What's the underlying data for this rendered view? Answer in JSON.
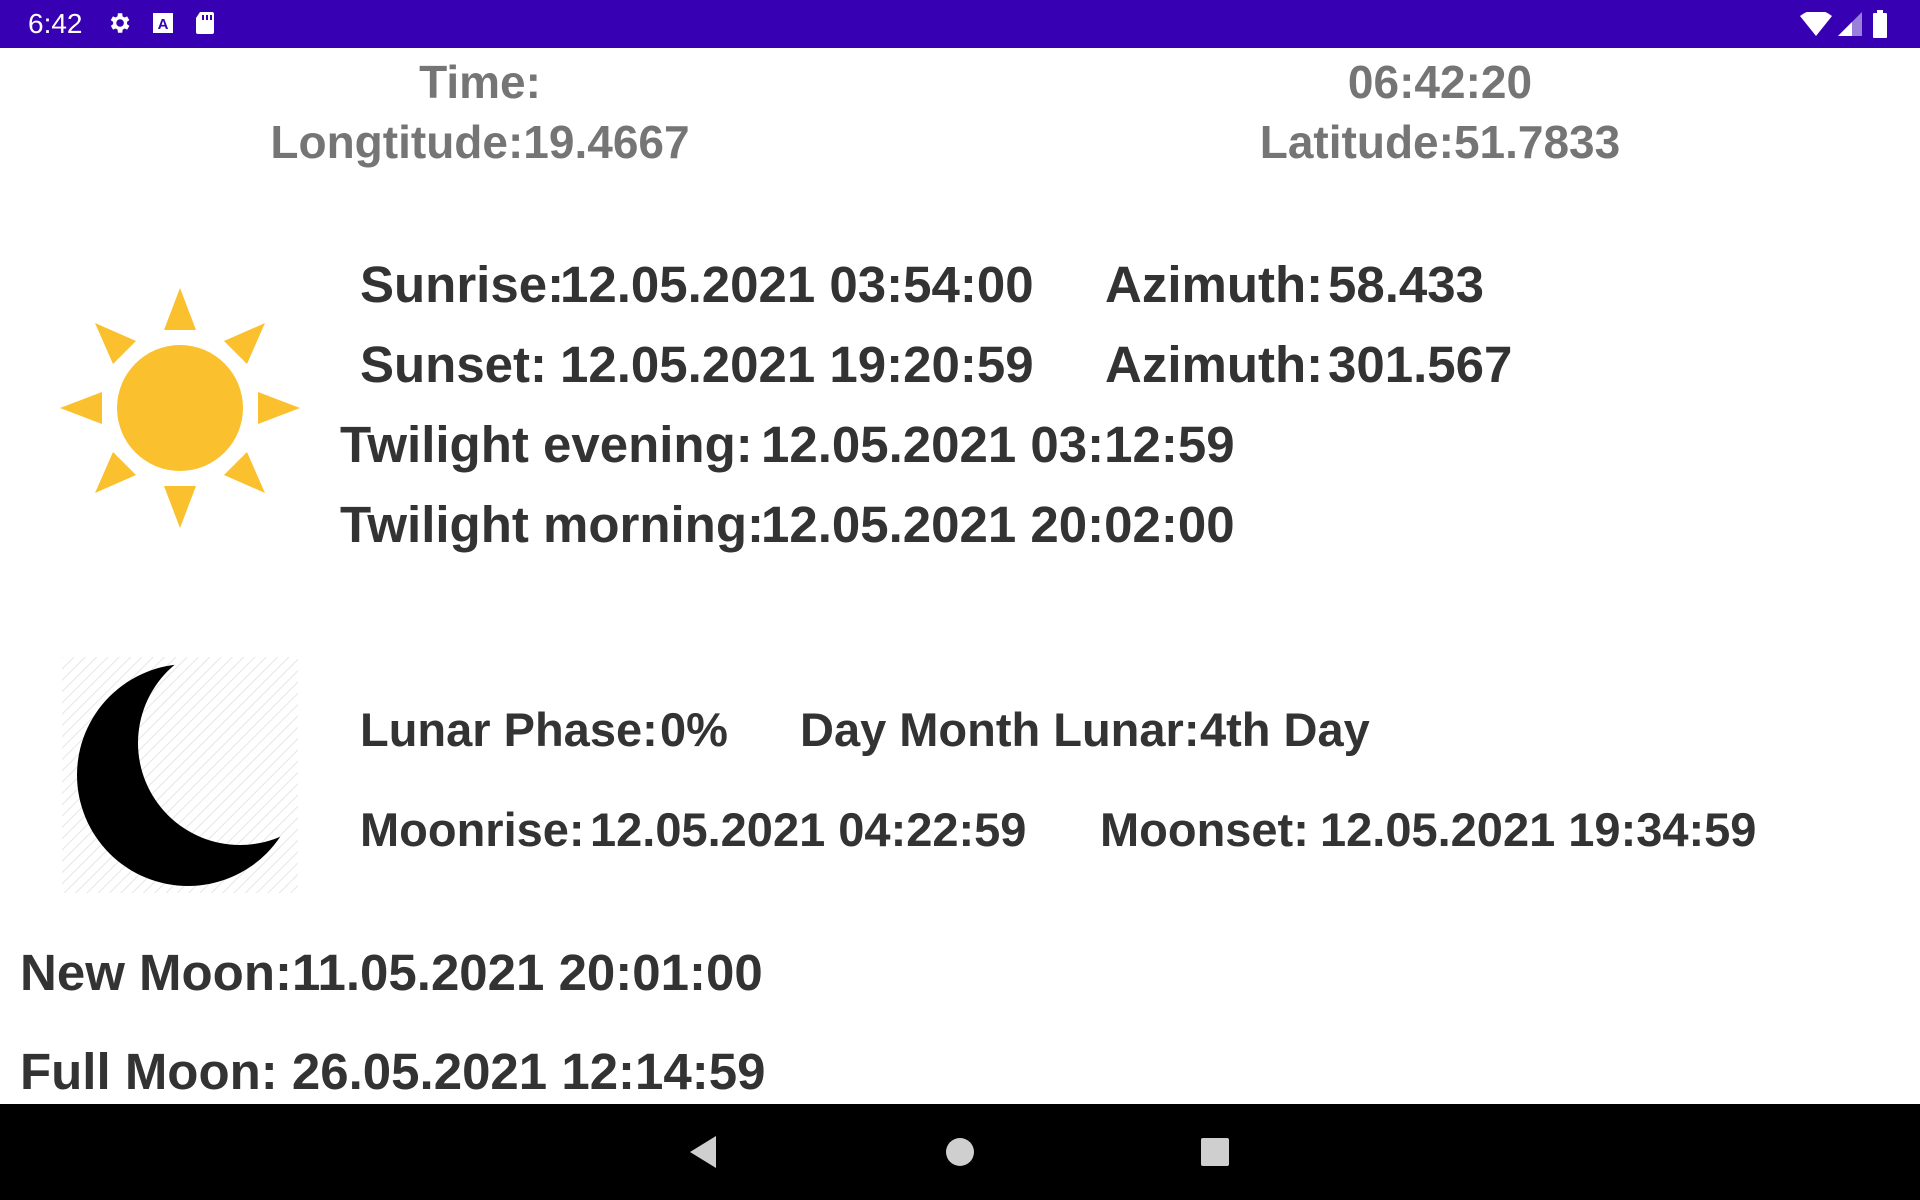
{
  "status_bar": {
    "time": "6:42",
    "icons": [
      "settings-icon",
      "a-notification-icon",
      "sd-card-icon",
      "wifi-icon",
      "signal-icon",
      "battery-icon"
    ]
  },
  "header": {
    "time_label": "Time:",
    "time_value": "06:42:20",
    "longitude": "Longtitude:19.4667",
    "latitude": "Latitude:51.7833"
  },
  "sun": {
    "icon": "sun-icon",
    "sunrise_label": "Sunrise:",
    "sunrise_value": "12.05.2021 03:54:00",
    "sunrise_azimuth_label": "Azimuth:",
    "sunrise_azimuth_value": "58.433",
    "sunset_label": "Sunset:",
    "sunset_value": "12.05.2021 19:20:59",
    "sunset_azimuth_label": "Azimuth:",
    "sunset_azimuth_value": "301.567",
    "twilight_evening_label": "Twilight evening:",
    "twilight_evening_value": "12.05.2021 03:12:59",
    "twilight_morning_label": "Twilight morning:",
    "twilight_morning_value": "12.05.2021 20:02:00"
  },
  "moon": {
    "icon": "moon-icon",
    "lunar_phase_label": "Lunar Phase:",
    "lunar_phase_value": "0%",
    "day_month_lunar_label": "Day Month Lunar:",
    "day_month_lunar_value": "4th Day",
    "moonrise_label": "Moonrise:",
    "moonrise_value": "12.05.2021 04:22:59",
    "moonset_label": "Moonset:",
    "moonset_value": "12.05.2021 19:34:59"
  },
  "phases": {
    "new_moon": "New Moon:11.05.2021 20:01:00",
    "full_moon": "Full Moon: 26.05.2021 12:14:59"
  },
  "nav_bar": {
    "buttons": [
      "back-icon",
      "home-icon",
      "recents-icon"
    ]
  },
  "colors": {
    "status_bar": "#3700B3",
    "sun": "#FBC02D",
    "header_text": "#757575",
    "body_text": "#333333"
  }
}
